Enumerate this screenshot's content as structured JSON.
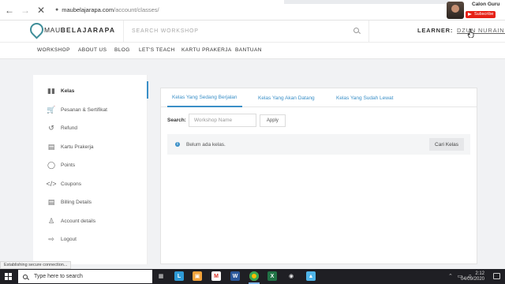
{
  "browser": {
    "url_host": "maubelajarapa.com",
    "url_path": "/account/classes/",
    "status_text": "Establishing secure connection..."
  },
  "overlay": {
    "channel_name": "Calon Guru",
    "subscribe_label": "Subscribe"
  },
  "header": {
    "logo_prefix": "MAU",
    "logo_main": "BELAJARAPA",
    "search_placeholder": "SEARCH WORKSHOP",
    "learner_label": "LEARNER:",
    "learner_name": "DZUN NURAINI"
  },
  "menu": {
    "items": [
      "WORKSHOP",
      "ABOUT US",
      "BLOG",
      "LET'S TEACH",
      "KARTU PRAKERJA",
      "BANTUAN"
    ]
  },
  "sidebar": {
    "items": [
      {
        "label": "Kelas",
        "icon": "books-icon",
        "active": true
      },
      {
        "label": "Pesanan & Sertifikat",
        "icon": "cart-icon"
      },
      {
        "label": "Refund",
        "icon": "refund-icon"
      },
      {
        "label": "Kartu Prakerja",
        "icon": "id-card-icon"
      },
      {
        "label": "Points",
        "icon": "points-icon"
      },
      {
        "label": "Coupons",
        "icon": "code-icon"
      },
      {
        "label": "Billing Details",
        "icon": "billing-icon"
      },
      {
        "label": "Account details",
        "icon": "user-icon"
      },
      {
        "label": "Logout",
        "icon": "logout-icon"
      }
    ]
  },
  "main": {
    "tabs": [
      "Kelas Yang Sedang Berjalan",
      "Kelas Yang Akan Datang",
      "Kelas Yang Sudah Lewat"
    ],
    "active_tab": 0,
    "search_label": "Search:",
    "search_placeholder": "Workshop Name",
    "apply_label": "Apply",
    "notice_text": "Belum ada kelas.",
    "cari_label": "Cari Kelas"
  },
  "taskbar": {
    "search_text": "Type here to search",
    "time": "2:12",
    "date": "04/09/2020"
  },
  "colors": {
    "accent": "#3a8fc7",
    "logo": "#3f8e99",
    "taskbar": "#1f1f24"
  }
}
